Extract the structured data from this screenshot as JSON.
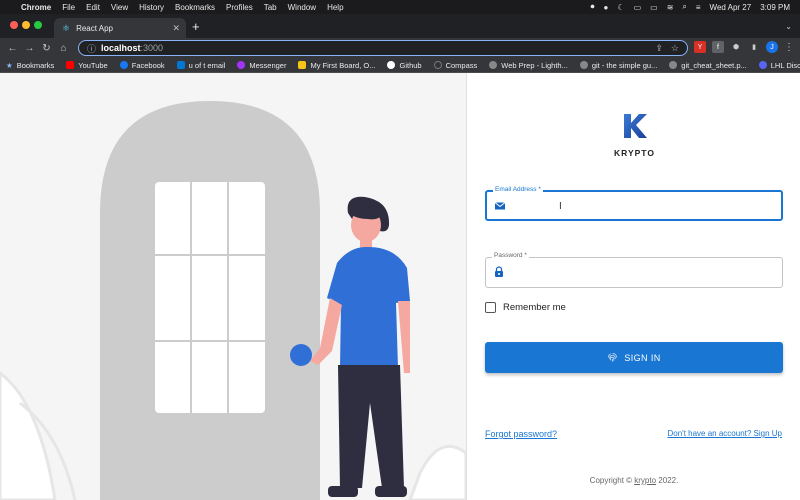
{
  "menubar": {
    "apple": "",
    "app": "Chrome",
    "items": [
      "File",
      "Edit",
      "View",
      "History",
      "Bookmarks",
      "Profiles",
      "Tab",
      "Window",
      "Help"
    ],
    "date": "Wed Apr 27",
    "time": "3:09 PM"
  },
  "tab": {
    "title": "React App",
    "close": "✕",
    "new_tab": "+"
  },
  "address": {
    "host": "localhost",
    "port": ":3000"
  },
  "bookmarks": [
    {
      "label": "Bookmarks",
      "color": "#8ab4f8"
    },
    {
      "label": "YouTube",
      "color": "#ff0000"
    },
    {
      "label": "Facebook",
      "color": "#1877f2"
    },
    {
      "label": "u of t email",
      "color": "#0078d4"
    },
    {
      "label": "Messenger",
      "color": "#a334fa"
    },
    {
      "label": "My First Board, O...",
      "color": "#f5c518"
    },
    {
      "label": "Github",
      "color": "#ffffff"
    },
    {
      "label": "Compass",
      "color": "#333333"
    },
    {
      "label": "Web Prep - Lighth...",
      "color": "#888888"
    },
    {
      "label": "git - the simple gu...",
      "color": "#888888"
    },
    {
      "label": "git_cheat_sheet.p...",
      "color": "#888888"
    },
    {
      "label": "LHL Discord",
      "color": "#5865f2"
    }
  ],
  "extensions": [
    {
      "label": "Y",
      "color": "#d93025"
    },
    {
      "label": "f",
      "color": "#5f6368"
    },
    {
      "label": "⬢",
      "color": "#5f6368"
    },
    {
      "label": "▮",
      "color": "#5f6368"
    },
    {
      "label": "J",
      "color": "#1a73e8"
    }
  ],
  "login": {
    "logo_letter": "K",
    "brand": "KRYPTO",
    "email_label": "Email Address *",
    "email_value": "",
    "password_label": "Password *",
    "password_value": "",
    "remember_label": "Remember me",
    "signin_label": "SIGN IN",
    "forgot_label": "Forgot password?",
    "signup_label": "Don't have an account? Sign Up",
    "copyright_prefix": "Copyright ©",
    "copyright_link": "krypto",
    "copyright_suffix": "2022."
  },
  "colors": {
    "primary": "#1976d2",
    "figure_shirt": "#2f6fd6",
    "figure_pants": "#2f2e41",
    "skin": "#f4a8a0",
    "arch": "#cccccc"
  }
}
